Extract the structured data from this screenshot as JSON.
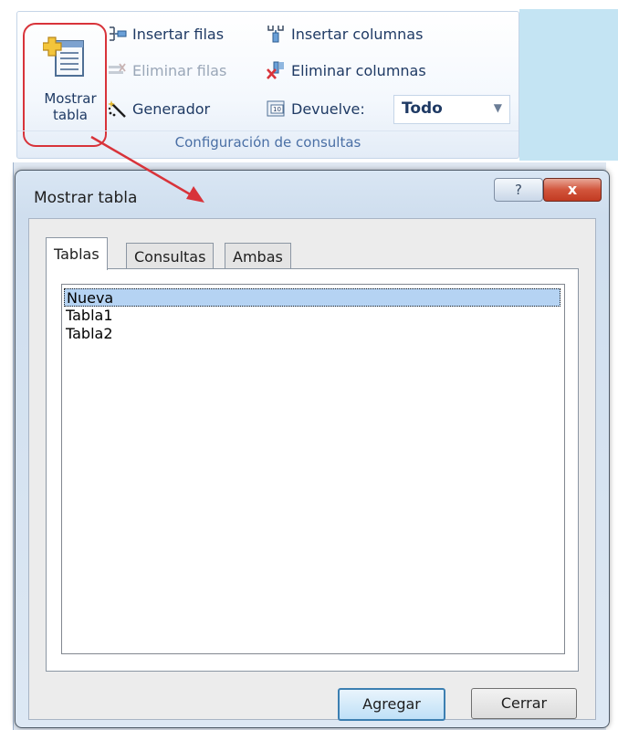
{
  "ribbon": {
    "show_table_label_line1": "Mostrar",
    "show_table_label_line2": "tabla",
    "commands": {
      "insert_rows": "Insertar filas",
      "delete_rows": "Eliminar filas",
      "builder": "Generador",
      "insert_columns": "Insertar columnas",
      "delete_columns": "Eliminar columnas",
      "returns": "Devuelve:"
    },
    "returns_value": "Todo",
    "group_title": "Configuración de consultas"
  },
  "dialog": {
    "title": "Mostrar tabla",
    "help_glyph": "?",
    "close_glyph": "x",
    "tabs": [
      {
        "label": "Tablas",
        "active": true
      },
      {
        "label": "Consultas",
        "active": false
      },
      {
        "label": "Ambas",
        "active": false
      }
    ],
    "items": [
      {
        "label": "Nueva",
        "selected": true
      },
      {
        "label": "Tabla1",
        "selected": false
      },
      {
        "label": "Tabla2",
        "selected": false
      }
    ],
    "add_label": "Agregar",
    "close_label": "Cerrar"
  },
  "colors": {
    "highlight": "#d8333a",
    "selection": "#b5d3f3",
    "ribbon_text": "#1f3a64"
  }
}
